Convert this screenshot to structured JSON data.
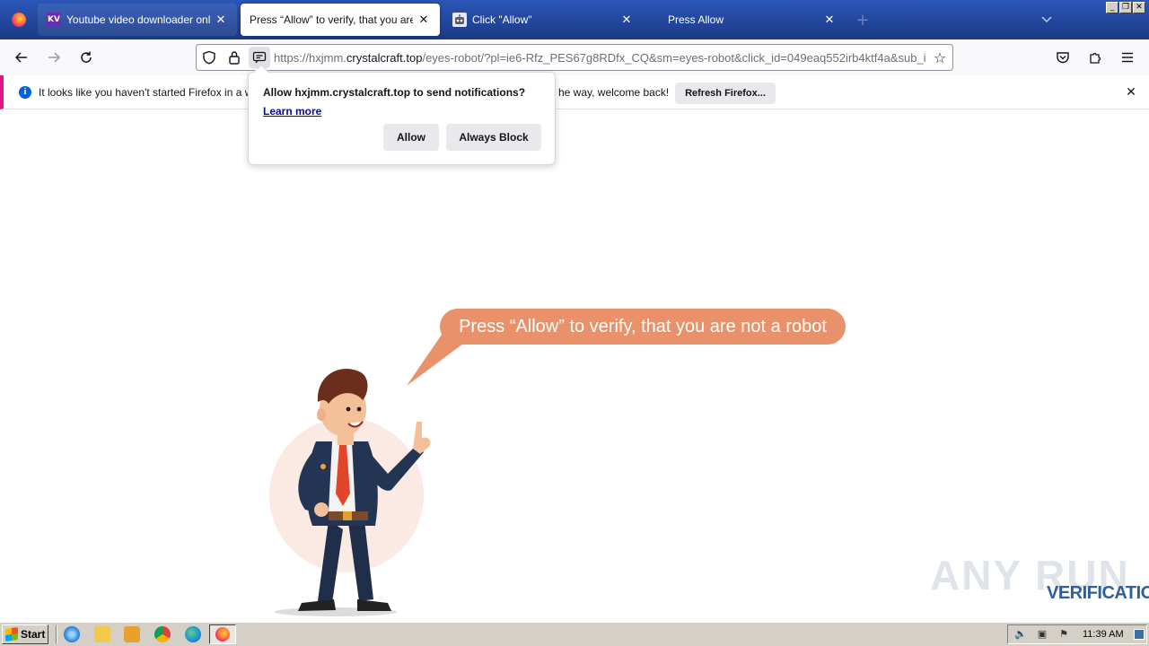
{
  "browser": {
    "tabs": [
      {
        "title": "Youtube video downloader online",
        "favicon": "kv-favicon-icon",
        "active": false
      },
      {
        "title": "Press “Allow” to verify, that you are not a robot",
        "favicon": "none",
        "active": true
      },
      {
        "title": "Click \"Allow\"",
        "favicon": "robot-favicon-icon",
        "active": false
      },
      {
        "title": "Press Allow",
        "favicon": "none",
        "active": false
      }
    ],
    "url_prefix": "https://hxjmm.",
    "url_domain": "crystalcraft.top",
    "url_suffix": "/eyes-robot/?pl=ie6-Rfz_PES67g8RDfx_CQ&sm=eyes-robot&click_id=049eaq552irb4ktf4a&sub_i"
  },
  "notification_bar": {
    "text_left": "It looks like you haven't started Firefox in a while",
    "text_right": "he way, welcome back!",
    "button": "Refresh Firefox..."
  },
  "permission_popup": {
    "message": "Allow hxjmm.crystalcraft.top to send notifications?",
    "learn_more": "Learn more",
    "allow_button": "Allow",
    "block_button": "Always Block"
  },
  "page": {
    "bubble_text": "Press “Allow” to verify, that you are not a robot",
    "bubble_color": "#e9916a",
    "watermark_top": "ANY RUN",
    "watermark_bottom": "VERIFICATION"
  },
  "taskbar": {
    "start_label": "Start",
    "clock": "11:39 AM"
  }
}
